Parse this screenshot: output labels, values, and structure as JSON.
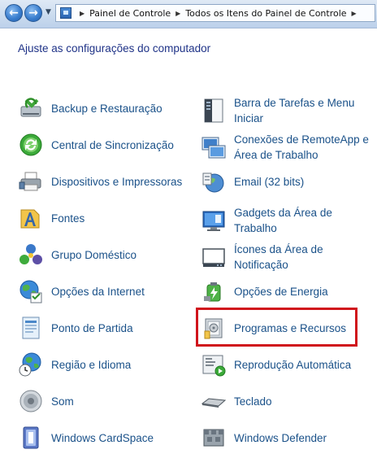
{
  "breadcrumb": {
    "items": [
      "Painel de Controle",
      "Todos os Itens do Painel de Controle"
    ]
  },
  "heading": "Ajuste as configurações do computador",
  "items": [
    {
      "label": "Backup e Restauração",
      "icon": "backup-icon"
    },
    {
      "label": "Barra de Tarefas e Menu Iniciar",
      "icon": "taskbar-icon"
    },
    {
      "label": "Central de Sincronização",
      "icon": "sync-icon"
    },
    {
      "label": "Conexões de RemoteApp e Área de Trabalho",
      "icon": "remoteapp-icon"
    },
    {
      "label": "Dispositivos e Impressoras",
      "icon": "printer-icon"
    },
    {
      "label": "Email (32 bits)",
      "icon": "email-icon"
    },
    {
      "label": "Fontes",
      "icon": "fonts-icon"
    },
    {
      "label": "Gadgets da Área de Trabalho",
      "icon": "gadgets-icon"
    },
    {
      "label": "Grupo Doméstico",
      "icon": "homegroup-icon"
    },
    {
      "label": "Ícones da Área de Notificação",
      "icon": "notification-icon"
    },
    {
      "label": "Opções da Internet",
      "icon": "internet-icon"
    },
    {
      "label": "Opções de Energia",
      "icon": "power-icon"
    },
    {
      "label": "Ponto de Partida",
      "icon": "getting-started-icon"
    },
    {
      "label": "Programas e Recursos",
      "icon": "programs-icon"
    },
    {
      "label": "Região e Idioma",
      "icon": "region-icon"
    },
    {
      "label": "Reprodução Automática",
      "icon": "autoplay-icon"
    },
    {
      "label": "Som",
      "icon": "sound-icon"
    },
    {
      "label": "Teclado",
      "icon": "keyboard-icon"
    },
    {
      "label": "Windows CardSpace",
      "icon": "cardspace-icon"
    },
    {
      "label": "Windows Defender",
      "icon": "defender-icon"
    }
  ],
  "highlight_color": "#d0141c",
  "link_color": "#1a5189",
  "heading_color": "#1e3287"
}
